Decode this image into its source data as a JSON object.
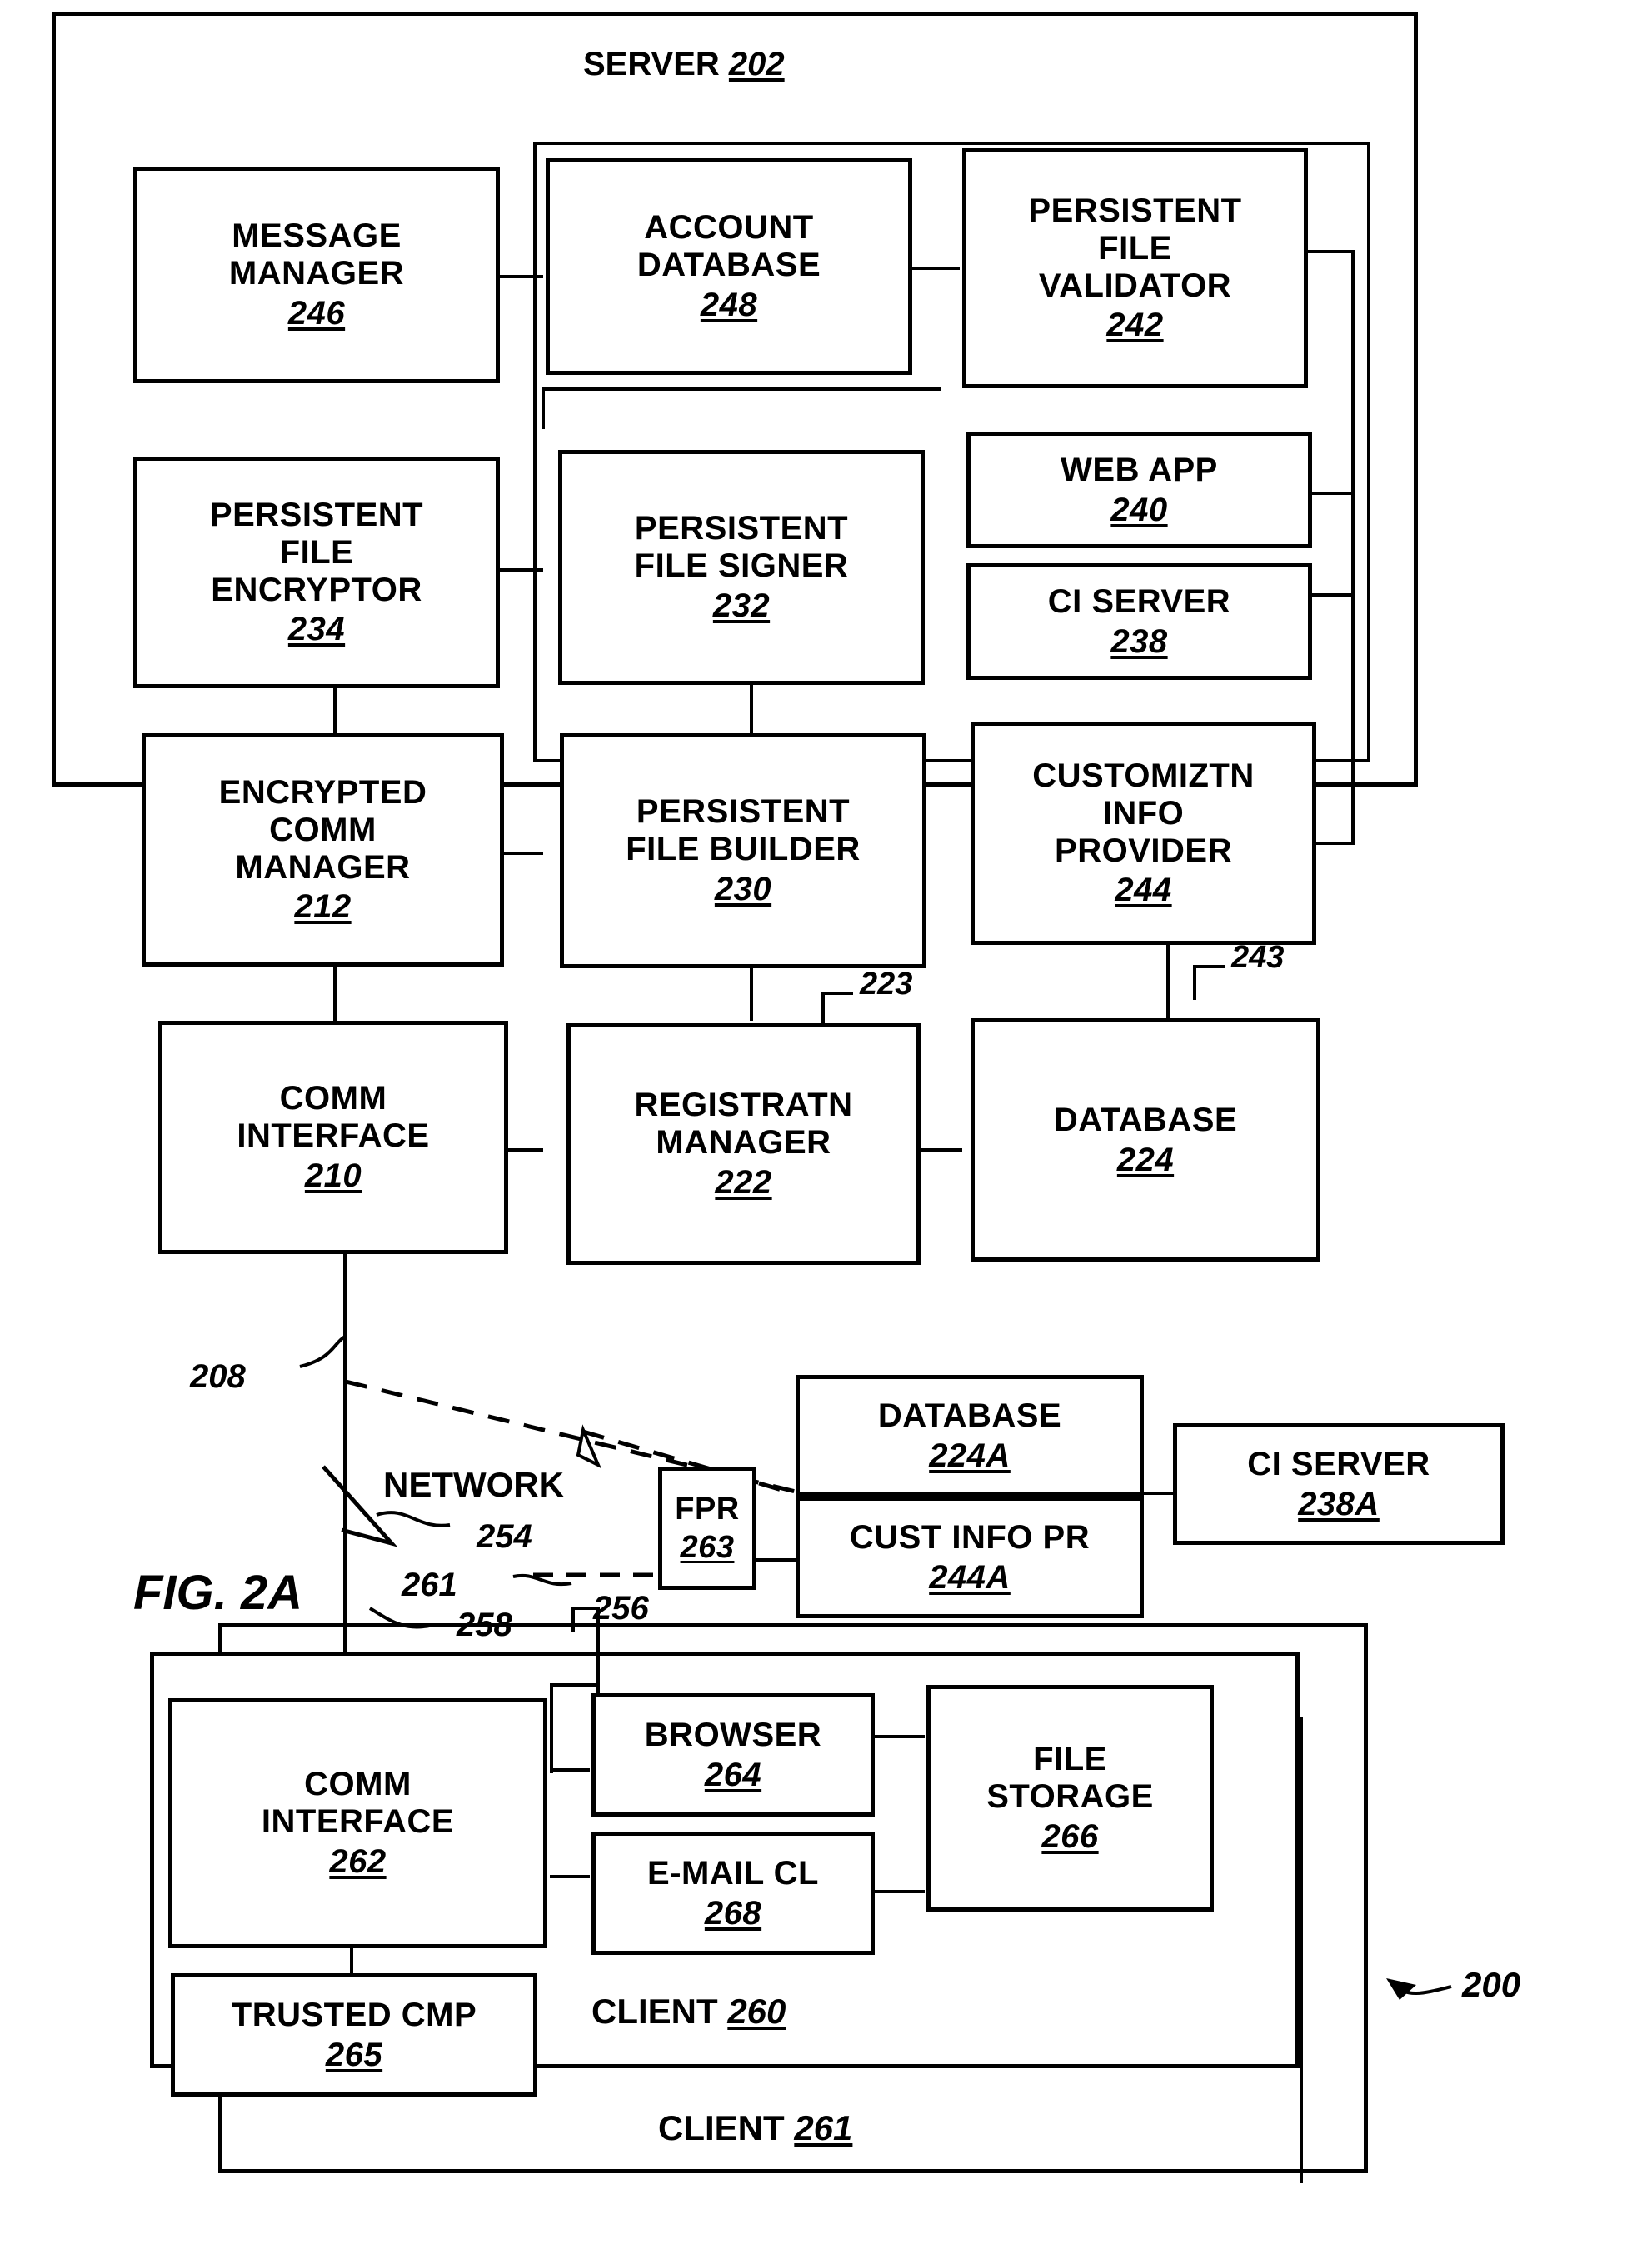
{
  "figure": {
    "label": "FIG. 2A",
    "system_ref": "200"
  },
  "server": {
    "title": "SERVER",
    "ref": "202",
    "modules": [
      {
        "name": "message-manager",
        "lines": [
          "MESSAGE",
          "MANAGER"
        ],
        "ref": "246"
      },
      {
        "name": "account-database",
        "lines": [
          "ACCOUNT",
          "DATABASE"
        ],
        "ref": "248"
      },
      {
        "name": "persistent-file-validator",
        "lines": [
          "PERSISTENT",
          "FILE",
          "VALIDATOR"
        ],
        "ref": "242"
      },
      {
        "name": "persistent-file-encryptor",
        "lines": [
          "PERSISTENT",
          "FILE",
          "ENCRYPTOR"
        ],
        "ref": "234"
      },
      {
        "name": "persistent-file-signer",
        "lines": [
          "PERSISTENT",
          "FILE SIGNER"
        ],
        "ref": "232"
      },
      {
        "name": "web-app",
        "lines": [
          "WEB APP"
        ],
        "ref": "240"
      },
      {
        "name": "ci-server",
        "lines": [
          "CI SERVER"
        ],
        "ref": "238"
      },
      {
        "name": "encrypted-comm-manager",
        "lines": [
          "ENCRYPTED",
          "COMM",
          "MANAGER"
        ],
        "ref": "212"
      },
      {
        "name": "persistent-file-builder",
        "lines": [
          "PERSISTENT",
          "FILE BUILDER"
        ],
        "ref": "230"
      },
      {
        "name": "customization-info-provider",
        "lines": [
          "CUSTOMIZTN",
          "INFO",
          "PROVIDER"
        ],
        "ref": "244"
      },
      {
        "name": "comm-interface",
        "lines": [
          "COMM",
          "INTERFACE"
        ],
        "ref": "210"
      },
      {
        "name": "registration-manager",
        "lines": [
          "REGISTRATN",
          "MANAGER"
        ],
        "ref": "222"
      },
      {
        "name": "database",
        "lines": [
          "DATABASE"
        ],
        "ref": "224"
      }
    ],
    "leader_refs": [
      "223",
      "243"
    ],
    "link_ref": "208"
  },
  "network": {
    "label": "NETWORK",
    "ref": "254",
    "link_refs": [
      "261",
      "258",
      "256"
    ]
  },
  "external": {
    "fpr": {
      "lines": [
        "FPR"
      ],
      "ref": "263"
    },
    "database_a": {
      "lines": [
        "DATABASE"
      ],
      "ref": "224A"
    },
    "cust_info_pr_a": {
      "lines": [
        "CUST INFO PR"
      ],
      "ref": "244A"
    },
    "ci_server_a": {
      "lines": [
        "CI SERVER"
      ],
      "ref": "238A"
    }
  },
  "client": {
    "title": "CLIENT",
    "ref": "260",
    "back_title": "CLIENT",
    "back_ref": "261",
    "modules": [
      {
        "name": "comm-interface",
        "lines": [
          "COMM",
          "INTERFACE"
        ],
        "ref": "262"
      },
      {
        "name": "browser",
        "lines": [
          "BROWSER"
        ],
        "ref": "264"
      },
      {
        "name": "file-storage",
        "lines": [
          "FILE",
          "STORAGE"
        ],
        "ref": "266"
      },
      {
        "name": "email-client",
        "lines": [
          "E-MAIL CL"
        ],
        "ref": "268"
      },
      {
        "name": "trusted-cmp",
        "lines": [
          "TRUSTED CMP"
        ],
        "ref": "265"
      }
    ]
  },
  "colors": {
    "ink": "#000000",
    "paper": "#ffffff"
  }
}
